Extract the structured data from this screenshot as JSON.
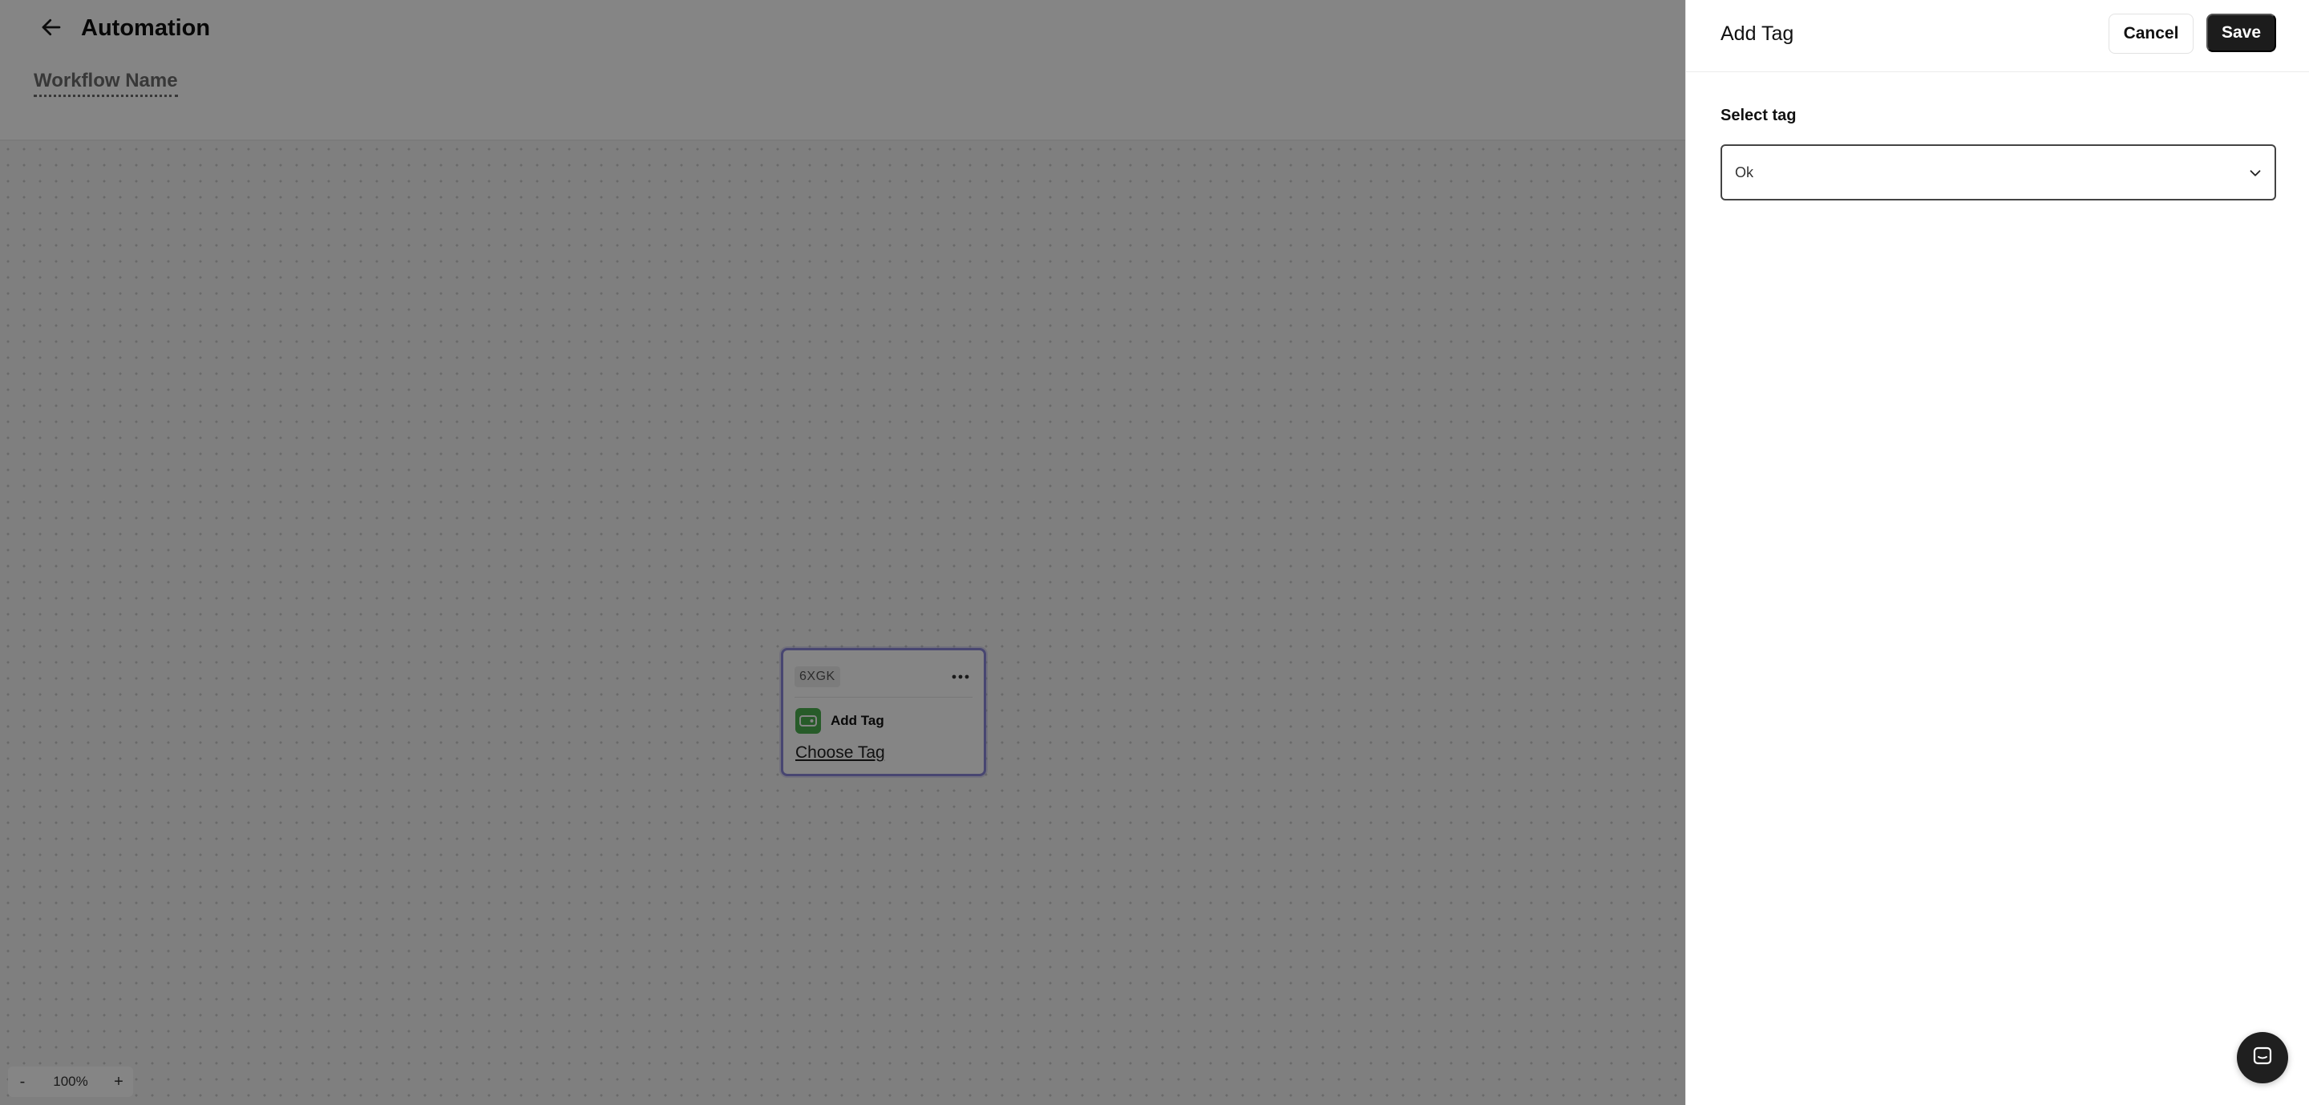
{
  "header": {
    "title": "Automation",
    "workflow_name": "Workflow Name",
    "back_icon": "arrow-left-icon"
  },
  "node": {
    "id": "6XGK",
    "action_label": "Add Tag",
    "choose_label": "Choose Tag",
    "icon": "tag-icon",
    "menu_icon": "more-horizontal-icon",
    "accent_color": "#8a86d8",
    "icon_bg_color": "#4caf50"
  },
  "zoom": {
    "minus": "-",
    "value": "100%",
    "plus": "+"
  },
  "drawer": {
    "title": "Add Tag",
    "cancel_label": "Cancel",
    "save_label": "Save",
    "field_label": "Select tag",
    "select_value": "Ok",
    "chevron_icon": "chevron-down-icon"
  },
  "chat": {
    "icon": "chat-icon"
  },
  "colors": {
    "overlay": "rgba(0,0,0,0.48)",
    "primary_button": "#1c1c1c"
  }
}
